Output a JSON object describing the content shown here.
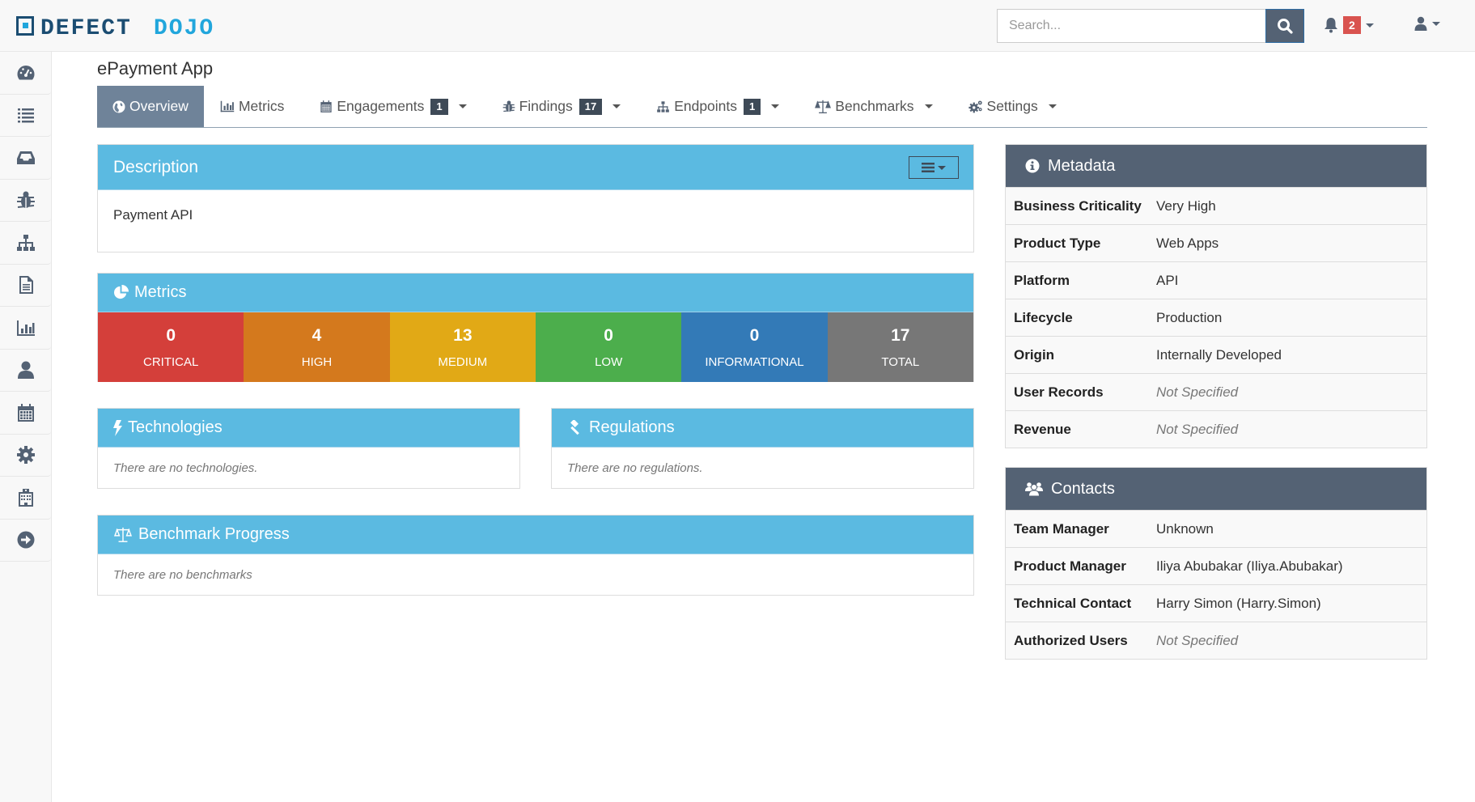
{
  "app": {
    "logo_text_dark": "DEFECT",
    "logo_text_light": "DOJO"
  },
  "navbar": {
    "search_placeholder": "Search...",
    "search_value": "",
    "alert_count": "2",
    "icons": [
      "search-icon",
      "bell-icon",
      "user-icon"
    ]
  },
  "sidebar": {
    "items": [
      {
        "name": "dashboard",
        "icon": "dashboard-icon"
      },
      {
        "name": "products",
        "icon": "list-icon"
      },
      {
        "name": "engagements",
        "icon": "inbox-icon"
      },
      {
        "name": "findings",
        "icon": "bug-icon"
      },
      {
        "name": "endpoints",
        "icon": "sitemap-icon"
      },
      {
        "name": "reports",
        "icon": "file-text-icon"
      },
      {
        "name": "metrics",
        "icon": "bar-chart-icon"
      },
      {
        "name": "users",
        "icon": "user-icon"
      },
      {
        "name": "calendar",
        "icon": "calendar-icon"
      },
      {
        "name": "configuration",
        "icon": "gear-icon"
      },
      {
        "name": "hospital",
        "icon": "building-icon"
      },
      {
        "name": "logout",
        "icon": "arrow-circle-right-icon"
      }
    ]
  },
  "page": {
    "title": "ePayment App"
  },
  "tabs": [
    {
      "label": "Overview",
      "icon": "globe-icon",
      "active": true
    },
    {
      "label": "Metrics",
      "icon": "bar-chart-icon"
    },
    {
      "label": "Engagements",
      "icon": "calendar-icon",
      "badge": "1",
      "dropdown": true
    },
    {
      "label": "Findings",
      "icon": "bug-icon",
      "badge": "17",
      "dropdown": true
    },
    {
      "label": "Endpoints",
      "icon": "sitemap-icon",
      "badge": "1",
      "dropdown": true
    },
    {
      "label": "Benchmarks",
      "icon": "balance-scale-icon",
      "dropdown": true
    },
    {
      "label": "Settings",
      "icon": "cogs-icon",
      "dropdown": true
    }
  ],
  "description": {
    "title": "Description",
    "body": "Payment API"
  },
  "metrics": {
    "title": "Metrics",
    "tiles": [
      {
        "value": "0",
        "label": "CRITICAL",
        "color": "#d43f3a"
      },
      {
        "value": "4",
        "label": "HIGH",
        "color": "#d4791d"
      },
      {
        "value": "13",
        "label": "MEDIUM",
        "color": "#e1a916"
      },
      {
        "value": "0",
        "label": "LOW",
        "color": "#4cae4c"
      },
      {
        "value": "0",
        "label": "INFORMATIONAL",
        "color": "#337ab7"
      },
      {
        "value": "17",
        "label": "TOTAL",
        "color": "#777777"
      }
    ]
  },
  "technologies": {
    "title": "Technologies",
    "empty": "There are no technologies."
  },
  "regulations": {
    "title": "Regulations",
    "empty": "There are no regulations."
  },
  "benchmark": {
    "title": "Benchmark Progress",
    "empty": "There are no benchmarks"
  },
  "metadata": {
    "title": "Metadata",
    "rows": [
      {
        "key": "Business Criticality",
        "value": "Very High"
      },
      {
        "key": "Product Type",
        "value": "Web Apps"
      },
      {
        "key": "Platform",
        "value": "API"
      },
      {
        "key": "Lifecycle",
        "value": "Production"
      },
      {
        "key": "Origin",
        "value": "Internally Developed"
      },
      {
        "key": "User Records",
        "value": "Not Specified",
        "unspecified": true
      },
      {
        "key": "Revenue",
        "value": "Not Specified",
        "unspecified": true
      }
    ]
  },
  "contacts": {
    "title": "Contacts",
    "rows": [
      {
        "key": "Team Manager",
        "value": "Unknown"
      },
      {
        "key": "Product Manager",
        "value": "Iliya Abubakar (Iliya.Abubakar)"
      },
      {
        "key": "Technical Contact",
        "value": "Harry Simon (Harry.Simon)"
      },
      {
        "key": "Authorized Users",
        "value": "Not Specified",
        "unspecified": true
      }
    ]
  }
}
